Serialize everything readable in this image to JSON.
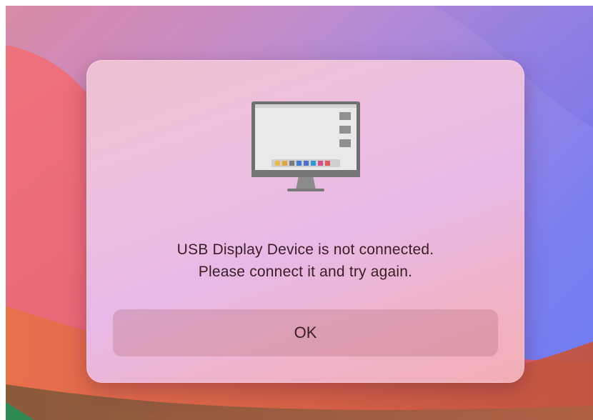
{
  "dialog": {
    "message_line1": "USB Display Device is not connected.",
    "message_line2": "Please connect it and try again.",
    "ok_label": "OK",
    "icon": "monitor-icon"
  },
  "colors": {
    "dialog_tint": "#efbcd4",
    "text": "#3a2025",
    "button_fill": "#d79aa3"
  }
}
